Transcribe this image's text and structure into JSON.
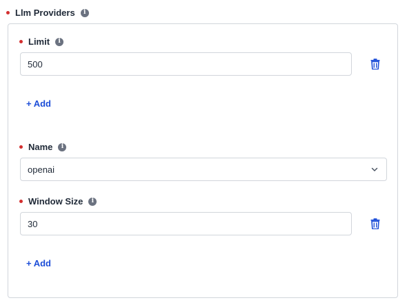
{
  "section": {
    "title": "Llm Providers"
  },
  "fields": {
    "limit": {
      "label": "Limit",
      "value": "500",
      "add_label": "+ Add"
    },
    "name": {
      "label": "Name",
      "selected": "openai"
    },
    "window_size": {
      "label": "Window Size",
      "value": "30",
      "add_label": "+ Add"
    }
  },
  "icons": {
    "info": "info-icon",
    "trash": "trash-icon",
    "chevron": "chevron-down-icon"
  },
  "colors": {
    "required": "#d32f2f",
    "link": "#1d4ed8",
    "trash": "#1d4ed8",
    "border": "#d1d5db"
  }
}
